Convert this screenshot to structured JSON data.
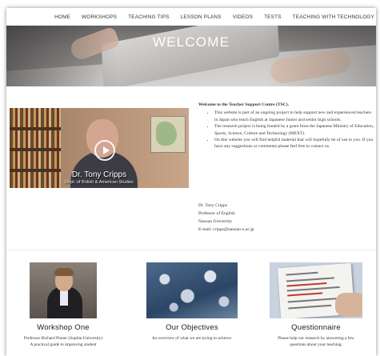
{
  "nav": {
    "items": [
      "HOME",
      "WORKSHOPS",
      "TEACHING TIPS",
      "LESSON PLANS",
      "VIDEOS",
      "TESTS",
      "TEACHING WITH TECHNOLOGY"
    ]
  },
  "hero": {
    "title": "WELCOME"
  },
  "video": {
    "name": "Dr. Tony Cripps",
    "subtitle": "Dept. of British & American Studies"
  },
  "intro": {
    "welcome": "Welcome to the Teacher Support Centre (TSC).",
    "bullets": [
      "This website is part of an ongoing project to help support new and experienced teachers in Japan who teach English at Japanese Junior and senior high schools.",
      "The research project is being funded by a grant from the Japanese Ministry of Education, Sports, Science, Culture and Technology (MEXT).",
      "On this website you will find helpful material that will hopefully be of use to you. If you have any suggestions or comments please feel free to contact us."
    ]
  },
  "signature": {
    "name": "Dr. Tony Cripps",
    "role": "Professor of English",
    "org": "Nanzan University",
    "email": "E-mail: cripps@nanzan-u.ac.jp"
  },
  "cards": [
    {
      "title": "Workshop One",
      "line1": "Professor Richard Pinner (Sophia University)",
      "line2": "A practical guide to improving student"
    },
    {
      "title": "Our Objectives",
      "line1": "An overview of what we are trying to achieve.",
      "line2": ""
    },
    {
      "title": "Questionnaire",
      "line1": "Please help our research by answering a few",
      "line2": "questions about your teaching."
    }
  ]
}
